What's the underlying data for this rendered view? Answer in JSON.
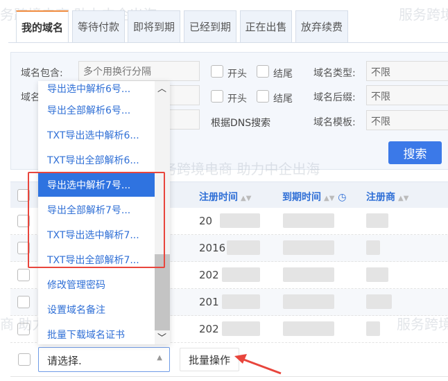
{
  "tabs": [
    "我的域名",
    "等待付款",
    "即将到期",
    "已经到期",
    "正在出售",
    "放弃续费"
  ],
  "filters": {
    "contains_label": "域名包含:",
    "contains_placeholder": "多个用换行分隔",
    "row2_label": "域名",
    "start": "开头",
    "end": "结尾",
    "dns_search": "根据DNS搜索",
    "type_label": "域名类型:",
    "type_value": "不限",
    "suffix_label": "域名后缀:",
    "suffix_value": "不限",
    "template_label": "域名模板:",
    "template_value": "不限",
    "search_button": "搜索"
  },
  "table": {
    "headers": [
      "注册时间",
      "到期时间",
      "注册商"
    ],
    "rows": [
      {
        "date": "20"
      },
      {
        "date": "2016"
      },
      {
        "date": "202"
      },
      {
        "date": "201"
      },
      {
        "date": "202"
      }
    ]
  },
  "dropdown": {
    "options": [
      "导出选中解析6号...",
      "导出全部解析6号...",
      "TXT导出选中解析6...",
      "TXT导出全部解析6...",
      "导出选中解析7号...",
      "导出全部解析7号...",
      "TXT导出选中解析7...",
      "TXT导出全部解析7...",
      "修改管理密码",
      "设置域名备注",
      "批量下载域名证书"
    ],
    "selected_index": 4
  },
  "bottom": {
    "select_value": "请选择.",
    "batch_button": "批量操作"
  },
  "watermark": "服务跨境电商 助力中企出海",
  "colors": {
    "accent": "#3b79e8",
    "link": "#2f6fd6",
    "highlight": "#e8453c"
  }
}
